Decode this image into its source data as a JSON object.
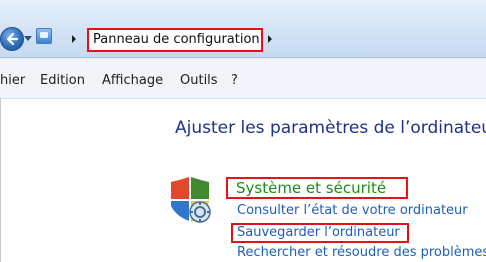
{
  "navigation": {
    "breadcrumb_label": "Panneau de configuration"
  },
  "menu": {
    "items": [
      "hier",
      "Edition",
      "Affichage",
      "Outils",
      "?"
    ]
  },
  "main": {
    "title": "Ajuster les paramètres de l’ordinateur",
    "category": {
      "title": "Système et sécurité",
      "tasks": [
        "Consulter l’état de votre ordinateur",
        "Sauvegarder l’ordinateur",
        "Rechercher et résoudre des problèmes"
      ]
    }
  },
  "colors": {
    "highlight_box": "#e8101a",
    "category_green": "#1f8a1f",
    "link_blue": "#1e5fb5",
    "title_blue": "#1e3287"
  },
  "icons": {
    "back": "back-arrow-icon",
    "control_panel": "control-panel-icon",
    "security": "shield-security-icon"
  }
}
